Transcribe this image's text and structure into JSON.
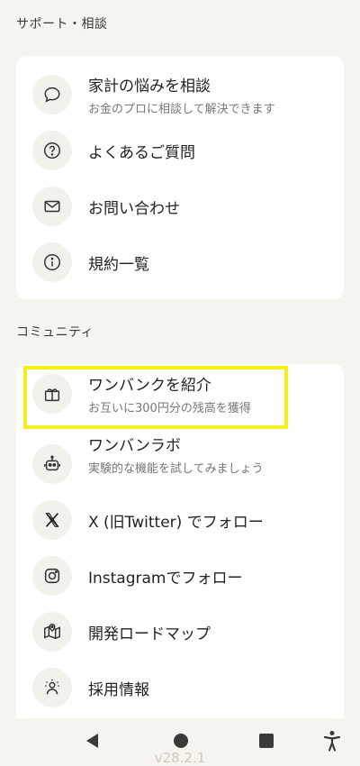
{
  "support": {
    "title": "サポート・相談",
    "items": [
      {
        "label": "家計の悩みを相談",
        "sub": "お金のプロに相談して解決できます",
        "icon": "chat-bubble-icon"
      },
      {
        "label": "よくあるご質問",
        "sub": "",
        "icon": "question-icon"
      },
      {
        "label": "お問い合わせ",
        "sub": "",
        "icon": "mail-icon"
      },
      {
        "label": "規約一覧",
        "sub": "",
        "icon": "info-icon"
      }
    ]
  },
  "community": {
    "title": "コミュニティ",
    "items": [
      {
        "label": "ワンバンクを紹介",
        "sub": "お互いに300円分の残高を獲得",
        "icon": "gift-icon"
      },
      {
        "label": "ワンバンラボ",
        "sub": "実験的な機能を試してみましょう",
        "icon": "robot-icon"
      },
      {
        "label": "X (旧Twitter) でフォロー",
        "sub": "",
        "icon": "x-logo-icon"
      },
      {
        "label": "Instagramでフォロー",
        "sub": "",
        "icon": "instagram-icon"
      },
      {
        "label": "開発ロードマップ",
        "sub": "",
        "icon": "map-pin-icon"
      },
      {
        "label": "採用情報",
        "sub": "",
        "icon": "people-sparkle-icon"
      }
    ]
  },
  "footer": {
    "version": "v28.2.1"
  },
  "colors": {
    "background": "#f6f4ef",
    "card": "#ffffff",
    "highlight": "#f5ee1a"
  }
}
